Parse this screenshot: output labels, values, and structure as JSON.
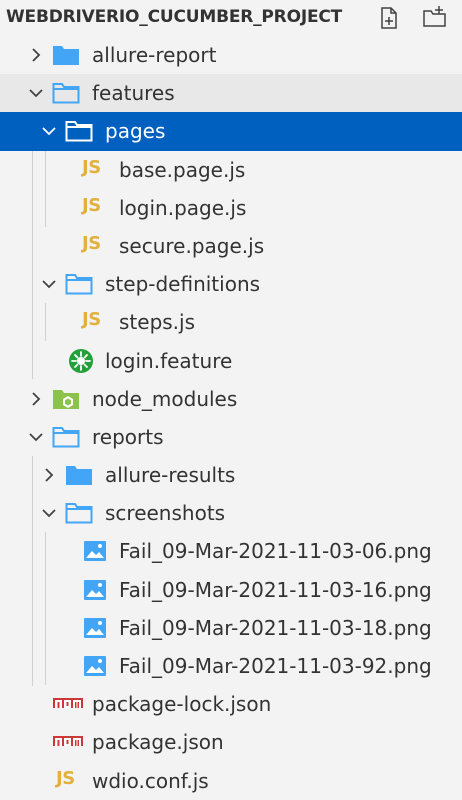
{
  "header": {
    "title": "WEBDRIVERIO_CUCUMBER_PROJECT",
    "new_file_icon": "new-file-icon",
    "new_folder_icon": "new-folder-icon"
  },
  "tree": {
    "items": [
      {
        "label": "allure-report",
        "kind": "folder",
        "expanded": false
      },
      {
        "label": "features",
        "kind": "folder",
        "expanded": true
      },
      {
        "label": "pages",
        "kind": "folder",
        "expanded": true,
        "selected": true
      },
      {
        "label": "base.page.js",
        "kind": "js",
        "badge": "JS"
      },
      {
        "label": "login.page.js",
        "kind": "js",
        "badge": "JS"
      },
      {
        "label": "secure.page.js",
        "kind": "js",
        "badge": "JS"
      },
      {
        "label": "step-definitions",
        "kind": "folder",
        "expanded": true
      },
      {
        "label": "steps.js",
        "kind": "js",
        "badge": "JS"
      },
      {
        "label": "login.feature",
        "kind": "cucumber"
      },
      {
        "label": "node_modules",
        "kind": "node-folder",
        "expanded": false
      },
      {
        "label": "reports",
        "kind": "folder",
        "expanded": true
      },
      {
        "label": "allure-results",
        "kind": "folder",
        "expanded": false
      },
      {
        "label": "screenshots",
        "kind": "folder",
        "expanded": true
      },
      {
        "label": "Fail_09-Mar-2021-11-03-06.png",
        "kind": "image"
      },
      {
        "label": "Fail_09-Mar-2021-11-03-16.png",
        "kind": "image"
      },
      {
        "label": "Fail_09-Mar-2021-11-03-18.png",
        "kind": "image"
      },
      {
        "label": "Fail_09-Mar-2021-11-03-92.png",
        "kind": "image"
      },
      {
        "label": "package-lock.json",
        "kind": "npm"
      },
      {
        "label": "package.json",
        "kind": "npm"
      },
      {
        "label": "wdio.conf.js",
        "kind": "js",
        "badge": "JS"
      }
    ]
  },
  "colors": {
    "selection": "#0060c0",
    "folder_blue": "#42a5f5",
    "js_yellow": "#e2b13c",
    "npm_red": "#cb3837",
    "cucumber_green": "#23a139"
  }
}
